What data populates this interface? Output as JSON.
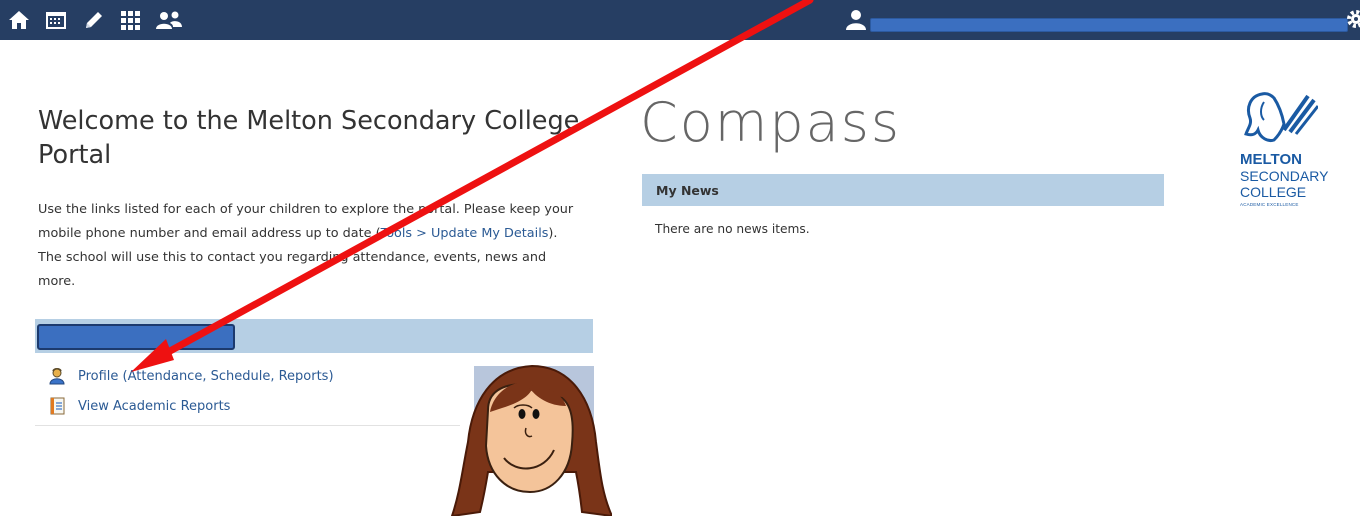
{
  "topbar": {
    "icons": [
      "home-icon",
      "calendar-icon",
      "pencil-icon",
      "grid-icon",
      "people-icon"
    ],
    "user_icon": "user-icon",
    "settings_icon": "gear-icon"
  },
  "welcome": {
    "title": "Welcome to the Melton Secondary College Portal",
    "text_before_link": "Use the links listed for each of your children to explore the portal. Please keep your mobile phone number and email address up to date (",
    "link_text": "Tools > Update My Details",
    "text_after_link": "). The school will use this to contact you regarding attendance, events, news and more."
  },
  "child_panel": {
    "links": [
      {
        "label": "Profile (Attendance, Schedule, Reports)",
        "icon": "profile-icon"
      },
      {
        "label": "View Academic Reports",
        "icon": "report-icon"
      }
    ]
  },
  "brand": {
    "compass_text": "Compass"
  },
  "news": {
    "header": "My News",
    "empty_text": "There are no news items."
  },
  "school_logo": {
    "line1": "MELTON",
    "line2": "SECONDARY",
    "line3": "COLLEGE",
    "tagline": "ACADEMIC EXCELLENCE"
  },
  "colors": {
    "topbar": "#263e63",
    "panel_header": "#b6cfe4",
    "link": "#2b5a94",
    "annotation_arrow": "#ee1111",
    "school_blue": "#1a5aa3"
  }
}
